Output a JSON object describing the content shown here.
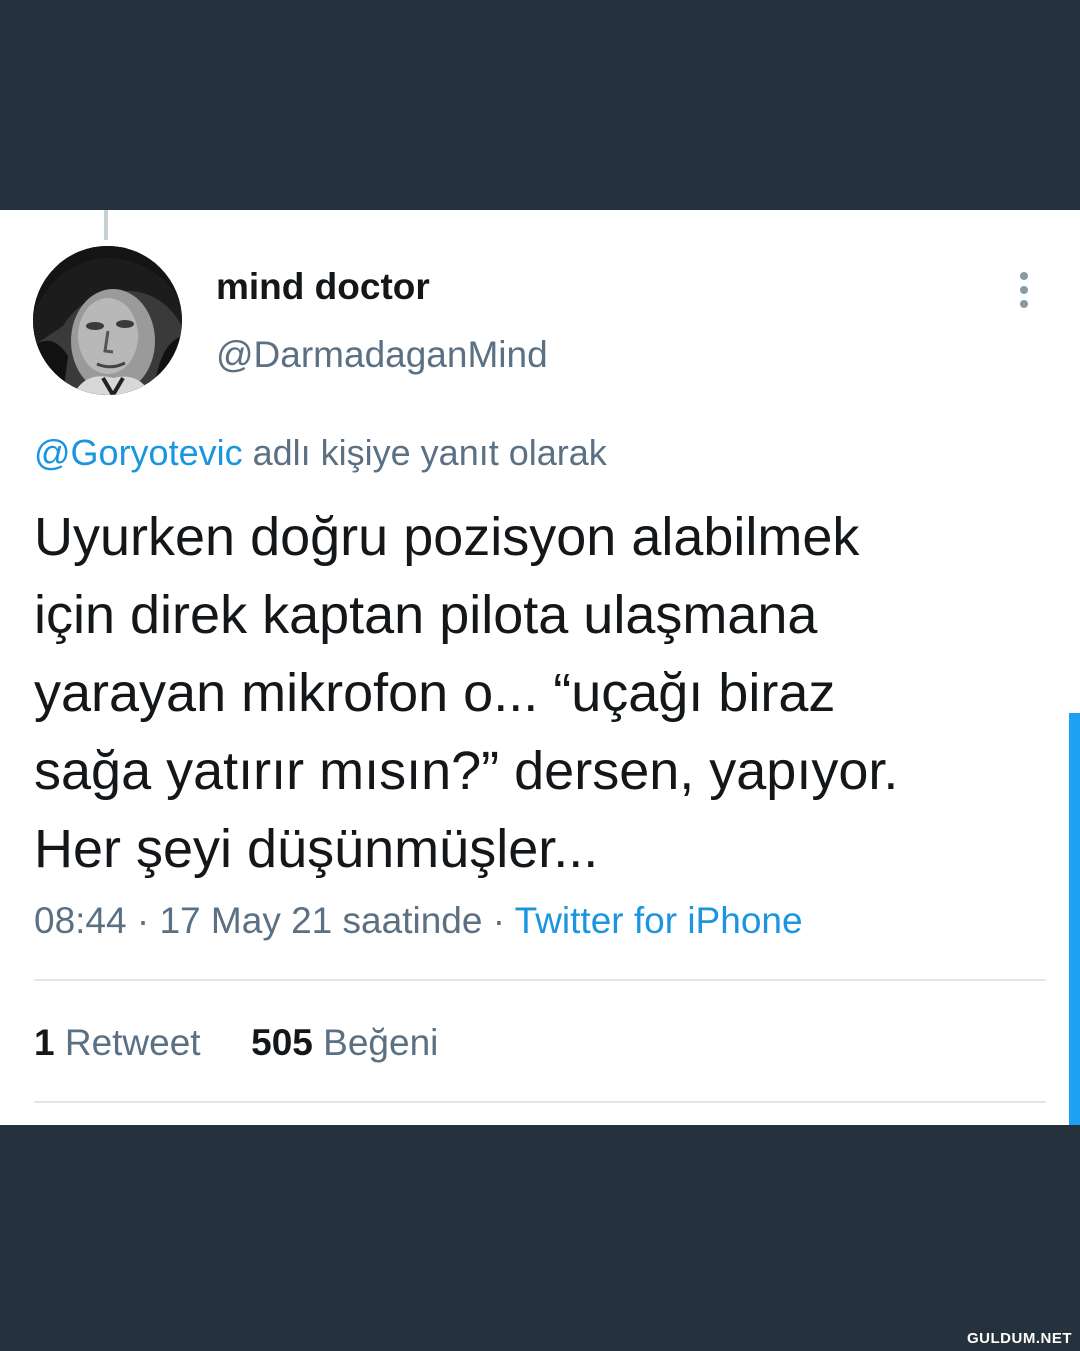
{
  "tweet": {
    "display_name": "mind doctor",
    "handle": "@DarmadaganMind",
    "reply_mention": "@Goryotevic",
    "reply_suffix": " adlı kişiye yanıt olarak",
    "text_lines": [
      "Uyurken doğru pozisyon alabilmek",
      "için direk kaptan pilota ulaşmana",
      "yarayan mikrofon o... “uçağı biraz",
      "sağa yatırır mısın?” dersen, yapıyor.",
      "Her şeyi düşünmüşler..."
    ],
    "time": "08:44",
    "separator": " · ",
    "date": "17 May 21 saatinde",
    "source": "Twitter for iPhone",
    "retweet_count": "1",
    "retweet_label": " Retweet",
    "like_count": "505",
    "like_label": " Beğeni"
  },
  "icons": {
    "more": "more-vertical-icon",
    "avatar": "profile-avatar"
  },
  "colors": {
    "background": "#25323d",
    "card": "#ffffff",
    "link": "#1b95e0",
    "secondary_text": "#5b7083",
    "primary_text": "#14171a",
    "scrollbar": "#1da1f2"
  },
  "watermark": "GULDUM.NET"
}
